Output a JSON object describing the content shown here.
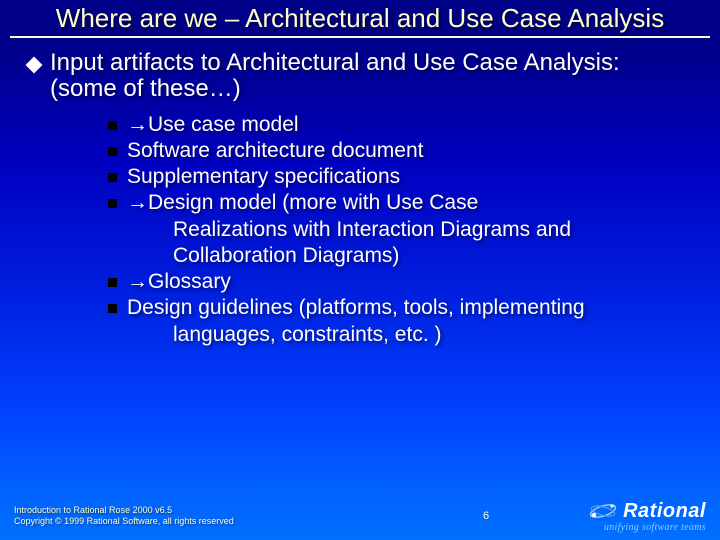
{
  "title": "Where are we – Architectural and Use Case Analysis",
  "lead": "Input artifacts to Architectural and Use Case Analysis: (some of these…)",
  "items": [
    {
      "text": "→Use case model",
      "cont": []
    },
    {
      "text": "Software architecture document",
      "cont": []
    },
    {
      "text": "Supplementary specifications",
      "cont": []
    },
    {
      "text": "→Design model (more with Use Case",
      "cont": [
        "Realizations with Interaction Diagrams and",
        "Collaboration Diagrams)"
      ]
    },
    {
      "text": "→Glossary",
      "cont": []
    },
    {
      "text": "Design guidelines (platforms, tools, implementing",
      "cont": [
        "languages, constraints,  etc. )"
      ]
    }
  ],
  "footer": {
    "line1": "Introduction to Rational Rose 2000 v6.5",
    "line2": "Copyright © 1999 Rational Software, all rights reserved",
    "page": "6",
    "brand": "Rational",
    "tagline": "unifying software teams"
  }
}
